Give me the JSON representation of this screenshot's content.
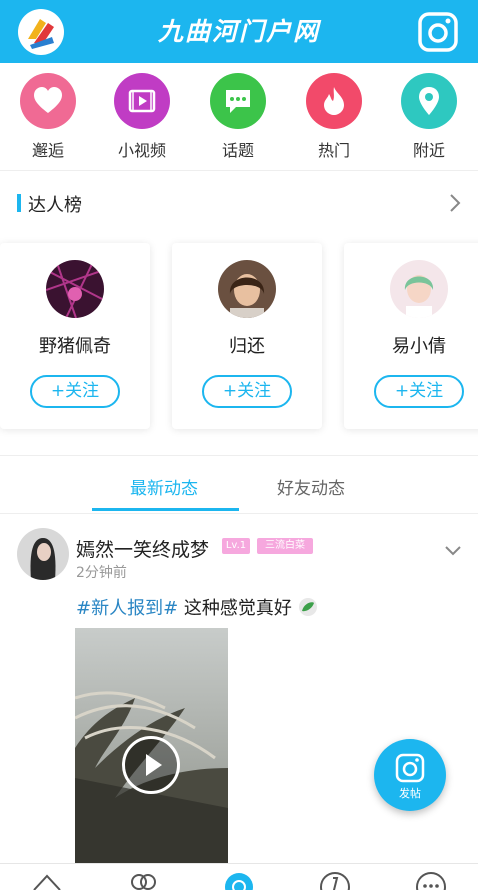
{
  "header": {
    "title": "九曲河门户网",
    "logo_icon": "app-logo-icon",
    "post_icon": "camera-post-icon",
    "bg_color": "#1cb6ef"
  },
  "quicknav": [
    {
      "label": "邂逅",
      "icon": "heart-icon",
      "color": "#f06a94"
    },
    {
      "label": "小视频",
      "icon": "video-icon",
      "color": "#c03cc4"
    },
    {
      "label": "话题",
      "icon": "chat-icon",
      "color": "#3cc44a"
    },
    {
      "label": "热门",
      "icon": "flame-icon",
      "color": "#f24a6a"
    },
    {
      "label": "附近",
      "icon": "location-pin-icon",
      "color": "#2ec8c0"
    }
  ],
  "talent": {
    "title": "达人榜",
    "users": [
      {
        "name": "野猪佩奇",
        "follow": "+关注"
      },
      {
        "name": "归还",
        "follow": "+关注"
      },
      {
        "name": "易小倩",
        "follow": "+关注"
      }
    ]
  },
  "tabs": [
    {
      "label": "最新动态",
      "active": true
    },
    {
      "label": "好友动态",
      "active": false
    }
  ],
  "post": {
    "author": "嫣然一笑终成梦",
    "level_badge": "Lv.1",
    "title_badge": "三流白菜",
    "time": "2分钟前",
    "tag": "#新人报到#",
    "text": " 这种感觉真好"
  },
  "fab": {
    "label": "发帖"
  },
  "colors": {
    "accent": "#1cb6ef",
    "tag": "#2a86c4"
  }
}
